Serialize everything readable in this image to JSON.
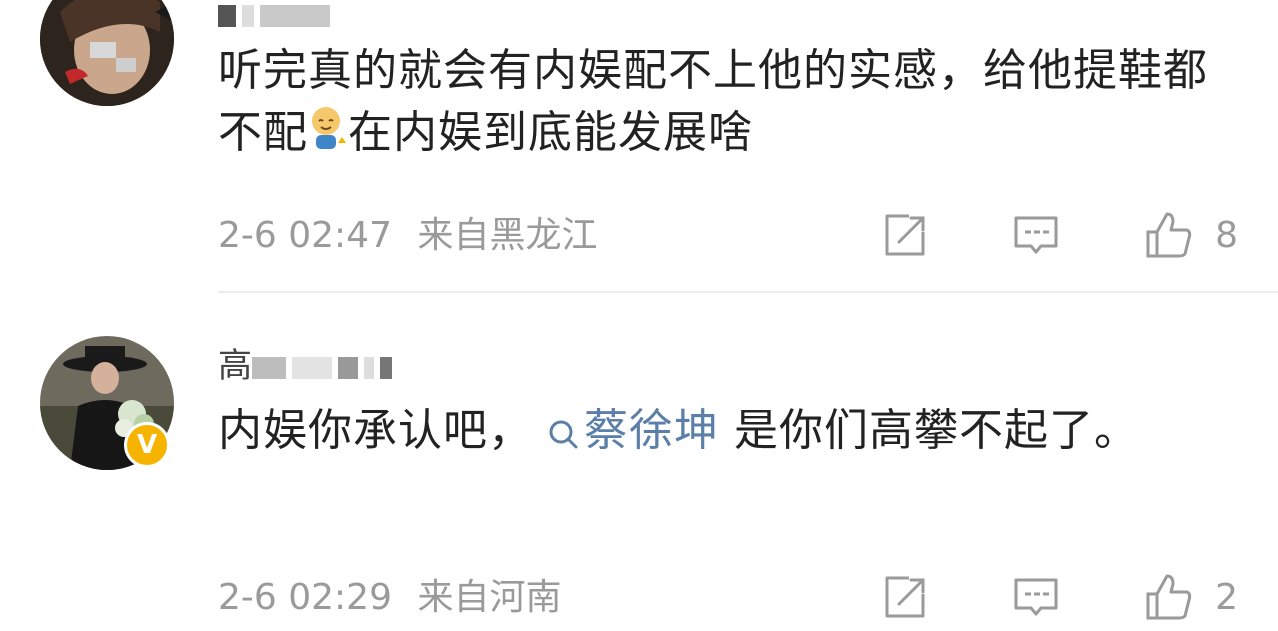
{
  "comments": [
    {
      "text_part1": "听完真的就会有内娱配不上他的实感，给他提鞋都不配",
      "emoji": "face-emoji",
      "text_part2": "在内娱到底能发展啥",
      "timestamp": "2-6 02:47",
      "location": "来自黑龙江",
      "like_count": "8"
    },
    {
      "name_visible": "高",
      "text_part1": "内娱你承认吧，",
      "topic": "蔡徐坤",
      "text_part2": "是你们高攀不起了。",
      "timestamp": "2-6 02:29",
      "location": "来自河南",
      "like_count": "2",
      "verified_badge": "V"
    }
  ],
  "icons": [
    "share-icon",
    "comment-icon",
    "like-icon",
    "search-icon"
  ],
  "colors": {
    "topic": "#5b7fa8",
    "badge": "#f6b400",
    "meta": "#9a9a9a"
  }
}
